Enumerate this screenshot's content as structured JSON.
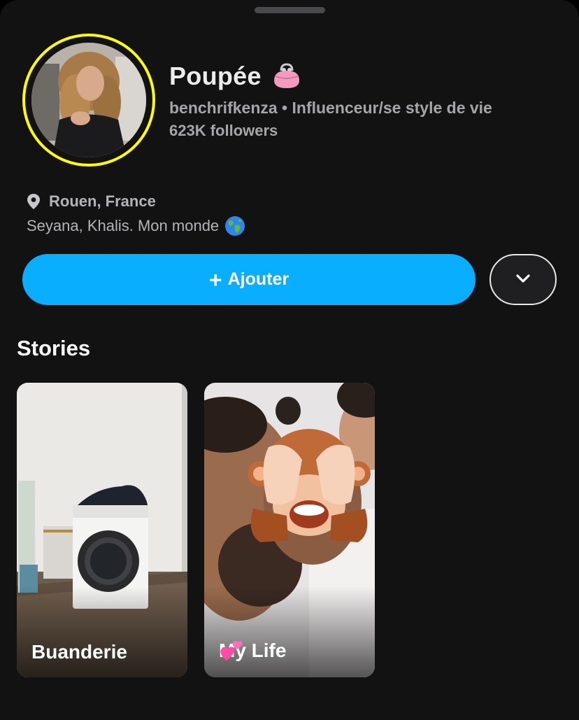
{
  "profile": {
    "display_name": "Poupée",
    "name_emoji_icon": "pink-purse-icon",
    "username": "benchrifkenza",
    "separator": "•",
    "category": "Influenceur/se style de vie",
    "followers": "623K followers",
    "location": "Rouen, France",
    "bio": "Seyana, Khalis. Mon monde",
    "bio_emoji_icon": "globe-icon"
  },
  "actions": {
    "add_label": "Ajouter",
    "add_icon": "plus-icon",
    "more_icon": "chevron-down-icon"
  },
  "stories": {
    "title": "Stories",
    "items": [
      {
        "label": "Buanderie"
      },
      {
        "label": "My Life",
        "emoji_icon": "two-hearts-icon"
      }
    ]
  },
  "colors": {
    "background": "#121212",
    "accent_blue": "#0aaeff",
    "story_ring": "#fffc00",
    "secondary_text": "#a5a5aa"
  }
}
